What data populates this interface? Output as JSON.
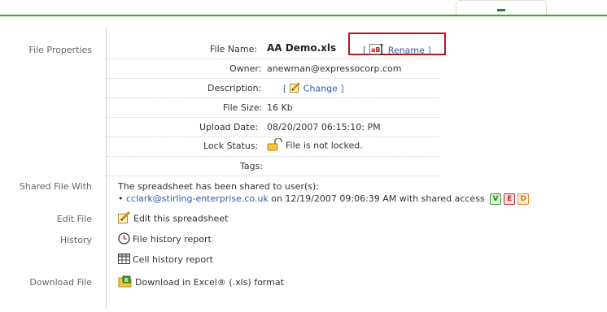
{
  "sections": {
    "file_properties": "File Properties",
    "shared_file_with": "Shared File With",
    "edit_file": "Edit File",
    "history": "History",
    "download_file": "Download File"
  },
  "properties": {
    "file_name": {
      "label": "File Name:",
      "value": "AA Demo.xls",
      "rename": "Rename",
      "bracket_open": "[",
      "bracket_close": "]"
    },
    "owner": {
      "label": "Owner:",
      "value": "anewman@expressocorp.com"
    },
    "description": {
      "label": "Description:",
      "change": "Change",
      "bracket_open": "[",
      "bracket_close": "]"
    },
    "file_size": {
      "label": "File Size:",
      "value": "16 Kb"
    },
    "upload_date": {
      "label": "Upload Date:",
      "value": "08/20/2007 06:15:10: PM"
    },
    "lock_status": {
      "label": "Lock Status:",
      "value": "File is not locked."
    },
    "tags": {
      "label": "Tags:",
      "value": ""
    }
  },
  "shared": {
    "intro": "The spreadsheet has been shared to user(s):",
    "bullet": "•",
    "user": "cclark@stirling-enterprise.co.uk",
    "on": "on",
    "date": "12/19/2007 09:06:39 AM",
    "with": "with shared access",
    "access": [
      "V",
      "E",
      "D"
    ]
  },
  "actions": {
    "edit": "Edit this spreadsheet",
    "file_history": "File history report",
    "cell_history": "Cell history report",
    "download": "Download in Excel® (.xls) format"
  },
  "colors": {
    "accent_green": "#46a03c",
    "highlight_red": "#c0141c",
    "link_blue": "#2a5ea6"
  }
}
